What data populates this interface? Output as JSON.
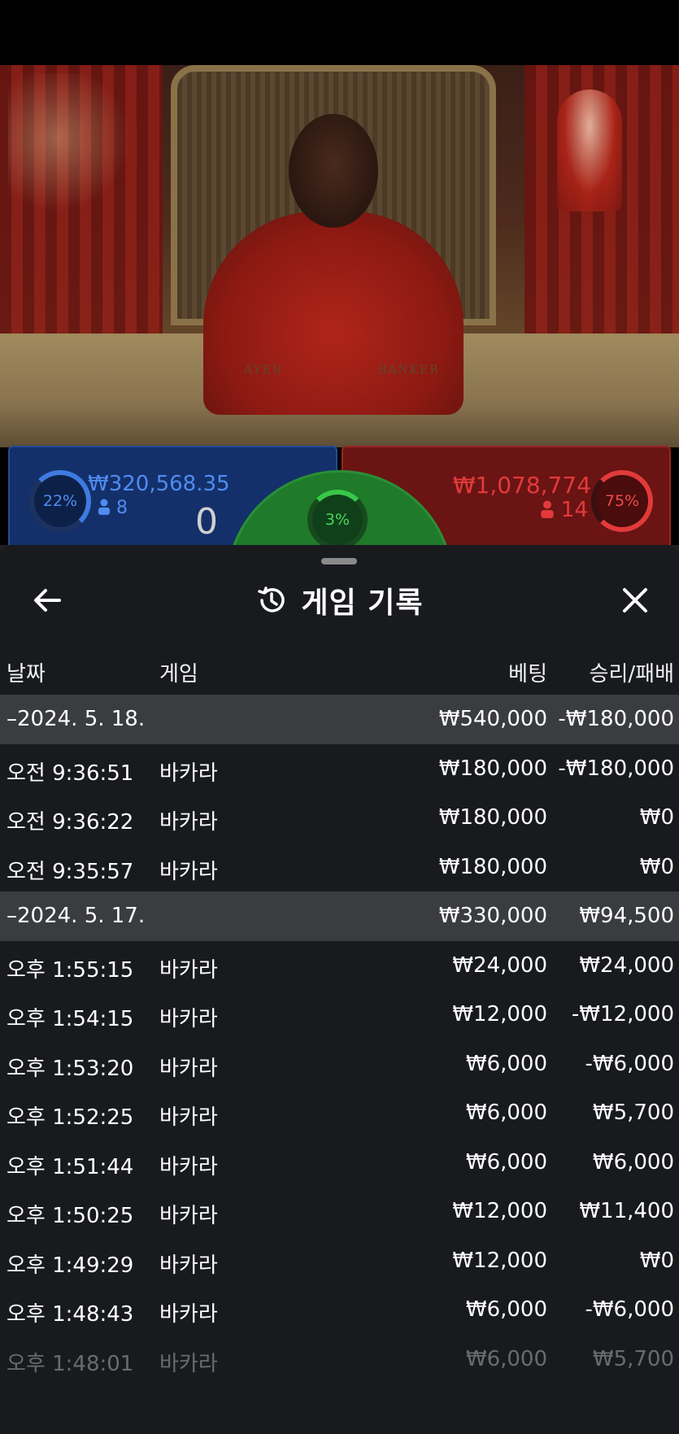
{
  "video": {
    "table_labels": {
      "player": "AYER",
      "banker": "BANKER"
    }
  },
  "bets": {
    "player_pct": "22%",
    "player_amount": "₩320,568.35",
    "player_count": "8",
    "player_score": "0",
    "tie_pct": "3%",
    "banker_amount": "₩1,078,774",
    "banker_count": "14",
    "banker_pct": "75%"
  },
  "history": {
    "title": "게임 기록",
    "columns": {
      "date": "날짜",
      "game": "게임",
      "bet": "베팅",
      "result": "승리/패배"
    },
    "rows": [
      {
        "type": "group",
        "time": "–2024. 5. 18.",
        "game": "",
        "bet": "₩540,000",
        "result": "-₩180,000"
      },
      {
        "type": "item",
        "time": "오전 9:36:51",
        "game": "바카라",
        "bet": "₩180,000",
        "result": "-₩180,000"
      },
      {
        "type": "item",
        "time": "오전 9:36:22",
        "game": "바카라",
        "bet": "₩180,000",
        "result": "₩0"
      },
      {
        "type": "item",
        "time": "오전 9:35:57",
        "game": "바카라",
        "bet": "₩180,000",
        "result": "₩0"
      },
      {
        "type": "group",
        "time": "–2024. 5. 17.",
        "game": "",
        "bet": "₩330,000",
        "result": "₩94,500"
      },
      {
        "type": "item",
        "time": "오후 1:55:15",
        "game": "바카라",
        "bet": "₩24,000",
        "result": "₩24,000"
      },
      {
        "type": "item",
        "time": "오후 1:54:15",
        "game": "바카라",
        "bet": "₩12,000",
        "result": "-₩12,000"
      },
      {
        "type": "item",
        "time": "오후 1:53:20",
        "game": "바카라",
        "bet": "₩6,000",
        "result": "-₩6,000"
      },
      {
        "type": "item",
        "time": "오후 1:52:25",
        "game": "바카라",
        "bet": "₩6,000",
        "result": "₩5,700"
      },
      {
        "type": "item",
        "time": "오후 1:51:44",
        "game": "바카라",
        "bet": "₩6,000",
        "result": "₩6,000"
      },
      {
        "type": "item",
        "time": "오후 1:50:25",
        "game": "바카라",
        "bet": "₩12,000",
        "result": "₩11,400"
      },
      {
        "type": "item",
        "time": "오후 1:49:29",
        "game": "바카라",
        "bet": "₩12,000",
        "result": "₩0"
      },
      {
        "type": "item",
        "time": "오후 1:48:43",
        "game": "바카라",
        "bet": "₩6,000",
        "result": "-₩6,000"
      },
      {
        "type": "item",
        "time": "오후 1:48:01",
        "game": "바카라",
        "bet": "₩6,000",
        "result": "₩5,700"
      }
    ]
  },
  "colors": {
    "player_blue": "#4f8cf0",
    "banker_red": "#e23a3a",
    "tie_green": "#38c848",
    "sheet_bg": "#181a1e",
    "group_row_bg": "#3a3c40"
  },
  "icons": {
    "back": "arrow-left-icon",
    "history": "history-clock-icon",
    "close": "close-icon"
  }
}
